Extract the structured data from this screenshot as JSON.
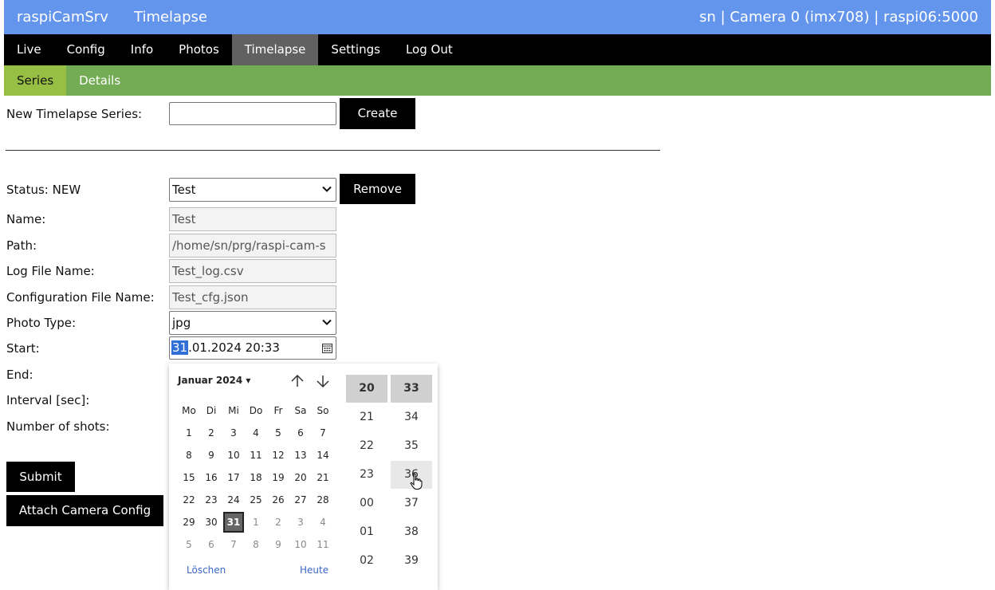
{
  "header": {
    "app_name": "raspiCamSrv",
    "page_title": "Timelapse",
    "session_info": "sn | Camera 0 (imx708) | raspi06:5000"
  },
  "nav": {
    "items": [
      "Live",
      "Config",
      "Info",
      "Photos",
      "Timelapse",
      "Settings",
      "Log Out"
    ],
    "active": "Timelapse"
  },
  "subnav": {
    "items": [
      "Series",
      "Details"
    ],
    "active": "Series"
  },
  "create": {
    "label": "New Timelapse Series:",
    "value": "",
    "button": "Create"
  },
  "series": {
    "status_label": "Status: NEW",
    "selected": "Test",
    "remove_button": "Remove",
    "name_label": "Name:",
    "name": "Test",
    "path_label": "Path:",
    "path": "/home/sn/prg/raspi-cam-s",
    "logfile_label": "Log File Name:",
    "logfile": "Test_log.csv",
    "cfgfile_label": "Configuration File Name:",
    "cfgfile": "Test_cfg.json",
    "phototype_label": "Photo Type:",
    "phototype": "jpg",
    "start_label": "Start:",
    "start_day": "31",
    "start_rest": ".01.2024 20:33",
    "end_label": "End:",
    "interval_label": "Interval [sec]:",
    "shots_label": "Number of shots:",
    "submit_button": "Submit",
    "attach_button": "Attach Camera Config"
  },
  "picker": {
    "month_label": "Januar 2024 ▾",
    "weekdays": [
      "Mo",
      "Di",
      "Mi",
      "Do",
      "Fr",
      "Sa",
      "So"
    ],
    "weeks": [
      [
        "1",
        "2",
        "3",
        "4",
        "5",
        "6",
        "7"
      ],
      [
        "8",
        "9",
        "10",
        "11",
        "12",
        "13",
        "14"
      ],
      [
        "15",
        "16",
        "17",
        "18",
        "19",
        "20",
        "21"
      ],
      [
        "22",
        "23",
        "24",
        "25",
        "26",
        "27",
        "28"
      ],
      [
        "29",
        "30",
        "31",
        "1",
        "2",
        "3",
        "4"
      ],
      [
        "5",
        "6",
        "7",
        "8",
        "9",
        "10",
        "11"
      ]
    ],
    "selected_day": "31",
    "clear_label": "Löschen",
    "today_label": "Heute",
    "hours": [
      "20",
      "21",
      "22",
      "23",
      "00",
      "01",
      "02"
    ],
    "minutes": [
      "33",
      "34",
      "35",
      "36",
      "37",
      "38",
      "39"
    ],
    "selected_hour": "20",
    "selected_minute": "33",
    "hover_minute": "36"
  }
}
